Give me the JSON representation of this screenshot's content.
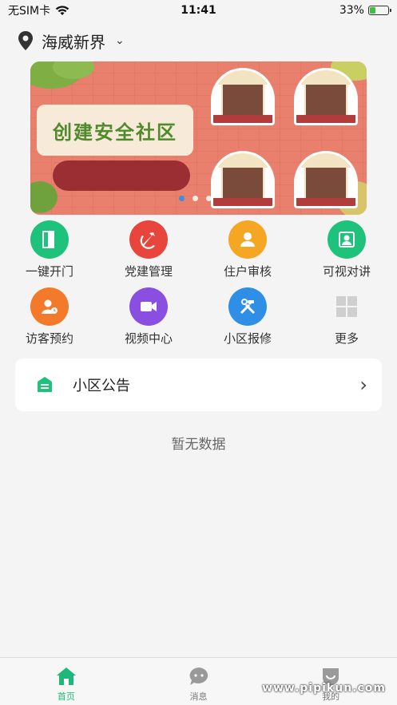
{
  "status_bar": {
    "carrier": "无SIM卡",
    "time": "11:41",
    "battery": "33%",
    "battery_level": 0.33
  },
  "header": {
    "location": "海威新界"
  },
  "banner": {
    "title": "创建安全社区",
    "active_slide": 1,
    "slide_count": 3
  },
  "grid": [
    {
      "label": "一键开门",
      "icon": "door-icon",
      "color": "#1ec27a"
    },
    {
      "label": "党建管理",
      "icon": "party-emblem-icon",
      "color": "#e8453c"
    },
    {
      "label": "住户审核",
      "icon": "resident-icon",
      "color": "#f5a623"
    },
    {
      "label": "可视对讲",
      "icon": "video-intercom-icon",
      "color": "#1ec27a"
    },
    {
      "label": "访客预约",
      "icon": "visitor-icon",
      "color": "#f37a2a"
    },
    {
      "label": "视频中心",
      "icon": "video-camera-icon",
      "color": "#8a4fe0"
    },
    {
      "label": "小区报修",
      "icon": "repair-tools-icon",
      "color": "#2f8fe6"
    },
    {
      "label": "更多",
      "icon": "more-grid-icon",
      "color": "#cccccc"
    }
  ],
  "notice": {
    "label": "小区公告",
    "icon": "notice-icon"
  },
  "empty_state": "暂无数据",
  "tabs": [
    {
      "label": "首页",
      "icon": "home-icon",
      "active": true
    },
    {
      "label": "消息",
      "icon": "message-icon",
      "active": false
    },
    {
      "label": "我的",
      "icon": "profile-icon",
      "active": false
    }
  ],
  "watermark": "www.pipikun.com"
}
